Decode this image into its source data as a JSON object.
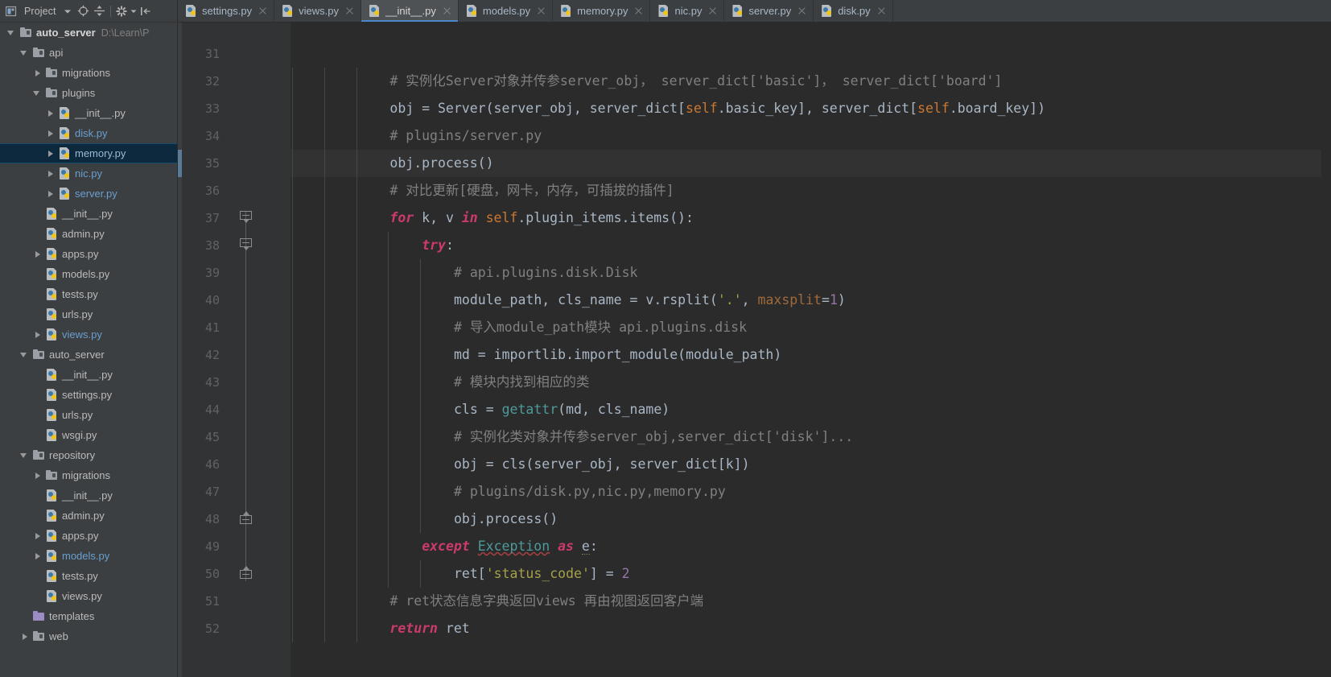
{
  "toolbar": {
    "title": "Project",
    "icons": [
      {
        "name": "chevron-down-icon",
        "glyph": "▾"
      },
      {
        "name": "locate-target-icon",
        "glyph": "⊕"
      },
      {
        "name": "expand-collapse-icon",
        "glyph": "÷"
      },
      {
        "name": "settings-gear-icon",
        "glyph": "✼"
      },
      {
        "name": "gear-dropdown-icon",
        "glyph": "▾"
      },
      {
        "name": "hide-panel-icon",
        "glyph": "⇥"
      }
    ]
  },
  "tabs": [
    {
      "label": "settings.py",
      "icon": "python-file-icon",
      "active": false
    },
    {
      "label": "views.py",
      "icon": "python-file-icon",
      "active": false
    },
    {
      "label": "__init__.py",
      "icon": "python-file-icon",
      "active": true
    },
    {
      "label": "models.py",
      "icon": "python-file-icon",
      "active": false
    },
    {
      "label": "memory.py",
      "icon": "python-file-icon",
      "active": false
    },
    {
      "label": "nic.py",
      "icon": "python-file-icon",
      "active": false
    },
    {
      "label": "server.py",
      "icon": "python-file-icon",
      "active": false
    },
    {
      "label": "disk.py",
      "icon": "python-file-icon",
      "active": false
    }
  ],
  "project_tree": [
    {
      "label": "auto_server",
      "path": "D:\\Learn\\P",
      "depth": 0,
      "arrow": "open",
      "icon": "folder",
      "style": "bold",
      "selected": false
    },
    {
      "label": "api",
      "path": "",
      "depth": 1,
      "arrow": "open",
      "icon": "folder",
      "style": "normal",
      "selected": false
    },
    {
      "label": "migrations",
      "path": "",
      "depth": 2,
      "arrow": "closed",
      "icon": "folder",
      "style": "normal",
      "selected": false
    },
    {
      "label": "plugins",
      "path": "",
      "depth": 2,
      "arrow": "open",
      "icon": "folder",
      "style": "normal",
      "selected": false
    },
    {
      "label": "__init__.py",
      "path": "",
      "depth": 3,
      "arrow": "closed",
      "icon": "py",
      "style": "normal",
      "selected": false
    },
    {
      "label": "disk.py",
      "path": "",
      "depth": 3,
      "arrow": "closed",
      "icon": "py",
      "style": "blue",
      "selected": false
    },
    {
      "label": "memory.py",
      "path": "",
      "depth": 3,
      "arrow": "closed",
      "icon": "py",
      "style": "blue",
      "selected": true
    },
    {
      "label": "nic.py",
      "path": "",
      "depth": 3,
      "arrow": "closed",
      "icon": "py",
      "style": "blue",
      "selected": false
    },
    {
      "label": "server.py",
      "path": "",
      "depth": 3,
      "arrow": "closed",
      "icon": "py",
      "style": "blue",
      "selected": false
    },
    {
      "label": "__init__.py",
      "path": "",
      "depth": 2,
      "arrow": "none",
      "icon": "py",
      "style": "normal",
      "selected": false
    },
    {
      "label": "admin.py",
      "path": "",
      "depth": 2,
      "arrow": "none",
      "icon": "py",
      "style": "normal",
      "selected": false
    },
    {
      "label": "apps.py",
      "path": "",
      "depth": 2,
      "arrow": "closed",
      "icon": "py",
      "style": "normal",
      "selected": false
    },
    {
      "label": "models.py",
      "path": "",
      "depth": 2,
      "arrow": "none",
      "icon": "py",
      "style": "normal",
      "selected": false
    },
    {
      "label": "tests.py",
      "path": "",
      "depth": 2,
      "arrow": "none",
      "icon": "py",
      "style": "normal",
      "selected": false
    },
    {
      "label": "urls.py",
      "path": "",
      "depth": 2,
      "arrow": "none",
      "icon": "py",
      "style": "normal",
      "selected": false
    },
    {
      "label": "views.py",
      "path": "",
      "depth": 2,
      "arrow": "closed",
      "icon": "py",
      "style": "blue",
      "selected": false
    },
    {
      "label": "auto_server",
      "path": "",
      "depth": 1,
      "arrow": "open",
      "icon": "folder",
      "style": "normal",
      "selected": false
    },
    {
      "label": "__init__.py",
      "path": "",
      "depth": 2,
      "arrow": "none",
      "icon": "py",
      "style": "normal",
      "selected": false
    },
    {
      "label": "settings.py",
      "path": "",
      "depth": 2,
      "arrow": "none",
      "icon": "py",
      "style": "normal",
      "selected": false
    },
    {
      "label": "urls.py",
      "path": "",
      "depth": 2,
      "arrow": "none",
      "icon": "py",
      "style": "normal",
      "selected": false
    },
    {
      "label": "wsgi.py",
      "path": "",
      "depth": 2,
      "arrow": "none",
      "icon": "py",
      "style": "normal",
      "selected": false
    },
    {
      "label": "repository",
      "path": "",
      "depth": 1,
      "arrow": "open",
      "icon": "folder",
      "style": "normal",
      "selected": false
    },
    {
      "label": "migrations",
      "path": "",
      "depth": 2,
      "arrow": "closed",
      "icon": "folder",
      "style": "normal",
      "selected": false
    },
    {
      "label": "__init__.py",
      "path": "",
      "depth": 2,
      "arrow": "none",
      "icon": "py",
      "style": "normal",
      "selected": false
    },
    {
      "label": "admin.py",
      "path": "",
      "depth": 2,
      "arrow": "none",
      "icon": "py",
      "style": "normal",
      "selected": false
    },
    {
      "label": "apps.py",
      "path": "",
      "depth": 2,
      "arrow": "closed",
      "icon": "py",
      "style": "normal",
      "selected": false
    },
    {
      "label": "models.py",
      "path": "",
      "depth": 2,
      "arrow": "closed",
      "icon": "py",
      "style": "blue",
      "selected": false
    },
    {
      "label": "tests.py",
      "path": "",
      "depth": 2,
      "arrow": "none",
      "icon": "py",
      "style": "normal",
      "selected": false
    },
    {
      "label": "views.py",
      "path": "",
      "depth": 2,
      "arrow": "none",
      "icon": "py",
      "style": "normal",
      "selected": false
    },
    {
      "label": "templates",
      "path": "",
      "depth": 1,
      "arrow": "none",
      "icon": "folder-plain",
      "style": "normal",
      "selected": false
    },
    {
      "label": "web",
      "path": "",
      "depth": 1,
      "arrow": "closed",
      "icon": "folder",
      "style": "normal",
      "selected": false
    }
  ],
  "editor": {
    "first_line": 31,
    "current_line": 35,
    "fold_markers": [
      {
        "line": 37,
        "type": "down"
      },
      {
        "line": 38,
        "type": "down"
      },
      {
        "line": 48,
        "type": "up"
      },
      {
        "line": 50,
        "type": "up"
      }
    ],
    "lines": [
      {
        "n": 31,
        "indent": 0,
        "tokens": []
      },
      {
        "n": 32,
        "indent": 3,
        "tokens": [
          {
            "t": "# 实例化Server对象并传参server_obj， server_dict['basic']， server_dict['board']",
            "c": "comment"
          }
        ]
      },
      {
        "n": 33,
        "indent": 3,
        "tokens": [
          {
            "t": "obj = Server(server_obj, server_dict[",
            "c": "default"
          },
          {
            "t": "self",
            "c": "selforange"
          },
          {
            "t": ".basic_key], server_dict[",
            "c": "default"
          },
          {
            "t": "self",
            "c": "selforange"
          },
          {
            "t": ".board_key])",
            "c": "default"
          }
        ]
      },
      {
        "n": 34,
        "indent": 3,
        "tokens": [
          {
            "t": "# plugins/server.py",
            "c": "comment"
          }
        ]
      },
      {
        "n": 35,
        "indent": 3,
        "tokens": [
          {
            "t": "obj.process()",
            "c": "default"
          }
        ]
      },
      {
        "n": 36,
        "indent": 3,
        "tokens": [
          {
            "t": "# 对比更新[硬盘，网卡，内存，可插拔的插件]",
            "c": "comment"
          }
        ]
      },
      {
        "n": 37,
        "indent": 3,
        "tokens": [
          {
            "t": "for",
            "c": "kwpink"
          },
          {
            "t": " k, v ",
            "c": "default"
          },
          {
            "t": "in",
            "c": "kwpink"
          },
          {
            "t": " ",
            "c": "default"
          },
          {
            "t": "self",
            "c": "selforange"
          },
          {
            "t": ".plugin_items.items():",
            "c": "default"
          }
        ]
      },
      {
        "n": 38,
        "indent": 4,
        "tokens": [
          {
            "t": "try",
            "c": "kwpink"
          },
          {
            "t": ":",
            "c": "default"
          }
        ]
      },
      {
        "n": 39,
        "indent": 5,
        "tokens": [
          {
            "t": "# api.plugins.disk.Disk",
            "c": "comment"
          }
        ]
      },
      {
        "n": 40,
        "indent": 5,
        "tokens": [
          {
            "t": "module_path, cls_name = v.rsplit(",
            "c": "default"
          },
          {
            "t": "'.'",
            "c": "str"
          },
          {
            "t": ", ",
            "c": "default"
          },
          {
            "t": "maxsplit",
            "c": "param"
          },
          {
            "t": "=",
            "c": "default"
          },
          {
            "t": "1",
            "c": "num"
          },
          {
            "t": ")",
            "c": "default"
          }
        ]
      },
      {
        "n": 41,
        "indent": 5,
        "tokens": [
          {
            "t": "# 导入module_path模块 api.plugins.disk",
            "c": "comment"
          }
        ]
      },
      {
        "n": 42,
        "indent": 5,
        "tokens": [
          {
            "t": "md = importlib.import_module(module_path)",
            "c": "default"
          }
        ]
      },
      {
        "n": 43,
        "indent": 5,
        "tokens": [
          {
            "t": "# 模块内找到相应的类",
            "c": "comment"
          }
        ]
      },
      {
        "n": 44,
        "indent": 5,
        "tokens": [
          {
            "t": "cls = ",
            "c": "default"
          },
          {
            "t": "getattr",
            "c": "fn"
          },
          {
            "t": "(md, cls_name)",
            "c": "default"
          }
        ]
      },
      {
        "n": 45,
        "indent": 5,
        "tokens": [
          {
            "t": "# 实例化类对象并传参server_obj,server_dict['disk']...",
            "c": "comment"
          }
        ]
      },
      {
        "n": 46,
        "indent": 5,
        "tokens": [
          {
            "t": "obj = cls(server_obj, server_dict[k])",
            "c": "default"
          }
        ]
      },
      {
        "n": 47,
        "indent": 5,
        "tokens": [
          {
            "t": "# plugins/disk.py,nic.py,memory.py",
            "c": "comment"
          }
        ]
      },
      {
        "n": 48,
        "indent": 5,
        "tokens": [
          {
            "t": "obj.process()",
            "c": "default"
          }
        ]
      },
      {
        "n": 49,
        "indent": 4,
        "tokens": [
          {
            "t": "except",
            "c": "kwpink"
          },
          {
            "t": " ",
            "c": "default"
          },
          {
            "t": "Exception",
            "c": "fn err"
          },
          {
            "t": " ",
            "c": "default"
          },
          {
            "t": "as",
            "c": "kwpink"
          },
          {
            "t": " ",
            "c": "default"
          },
          {
            "t": "e",
            "c": "default warnunder"
          },
          {
            "t": ":",
            "c": "default"
          }
        ]
      },
      {
        "n": 50,
        "indent": 5,
        "tokens": [
          {
            "t": "ret[",
            "c": "default"
          },
          {
            "t": "'status_code'",
            "c": "str"
          },
          {
            "t": "] = ",
            "c": "default"
          },
          {
            "t": "2",
            "c": "num"
          }
        ]
      },
      {
        "n": 51,
        "indent": 3,
        "tokens": [
          {
            "t": "# ret状态信息字典返回views 再由视图返回客户端",
            "c": "comment"
          }
        ]
      },
      {
        "n": 52,
        "indent": 3,
        "tokens": [
          {
            "t": "return",
            "c": "kwpink"
          },
          {
            "t": " ret",
            "c": "default"
          }
        ]
      }
    ]
  },
  "colors": {
    "editor_bg": "#2b2b2b",
    "panel_bg": "#3c3f41",
    "gutter_bg": "#313335",
    "selection_bg": "#0d293e",
    "tab_active_bg": "#4e5254",
    "tab_active_underline": "#4a88c7",
    "text": "#a9b7c6",
    "comment": "#808080",
    "keyword": "#cc3a6b",
    "self_keyword": "#cc7832",
    "string": "#a5a04b",
    "number": "#9876aa",
    "builtin_fn": "#4e9a9a",
    "param": "#a06a3a",
    "link_blue": "#6a9fd0"
  }
}
